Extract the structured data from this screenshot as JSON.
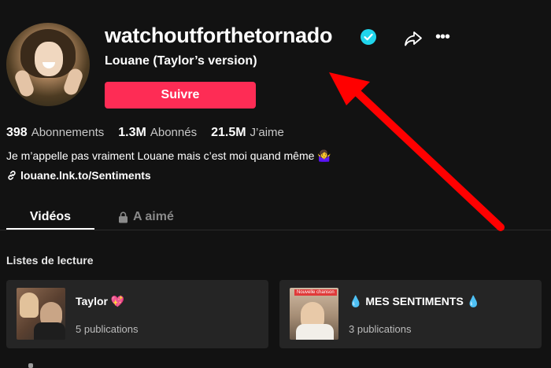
{
  "profile": {
    "username": "watchoutforthetornado",
    "display_name": "Louane (Taylor’s version)",
    "follow_label": "Suivre",
    "bio": "Je m’appelle pas vraiment Louane mais c’est moi quand même 🤷‍♀️",
    "link": "louane.lnk.to/Sentiments",
    "verified": true
  },
  "stats": [
    {
      "value": "398",
      "label": "Abonnements"
    },
    {
      "value": "1.3M",
      "label": "Abonnés"
    },
    {
      "value": "21.5M",
      "label": "J’aime"
    }
  ],
  "tabs": [
    {
      "label": "Vidéos",
      "active": true
    },
    {
      "label": "A aimé",
      "active": false,
      "icon": "lock-icon"
    }
  ],
  "playlists": {
    "section_title": "Listes de lecture",
    "items": [
      {
        "title": "Taylor",
        "emoji": "💖",
        "count": "5 publications"
      },
      {
        "title_prefix": "💧",
        "title": "MES SENTIMENTS",
        "title_suffix": "💧",
        "count": "3 publications",
        "thumb_tag": "Nouvelle chanson"
      }
    ]
  },
  "colors": {
    "background": "#121212",
    "follow_button": "#fe2c55",
    "verified": "#20d5ec",
    "annotation_arrow": "#ff0000"
  },
  "icons": [
    "verified-badge-icon",
    "share-icon",
    "more-icon",
    "link-icon",
    "lock-icon"
  ]
}
